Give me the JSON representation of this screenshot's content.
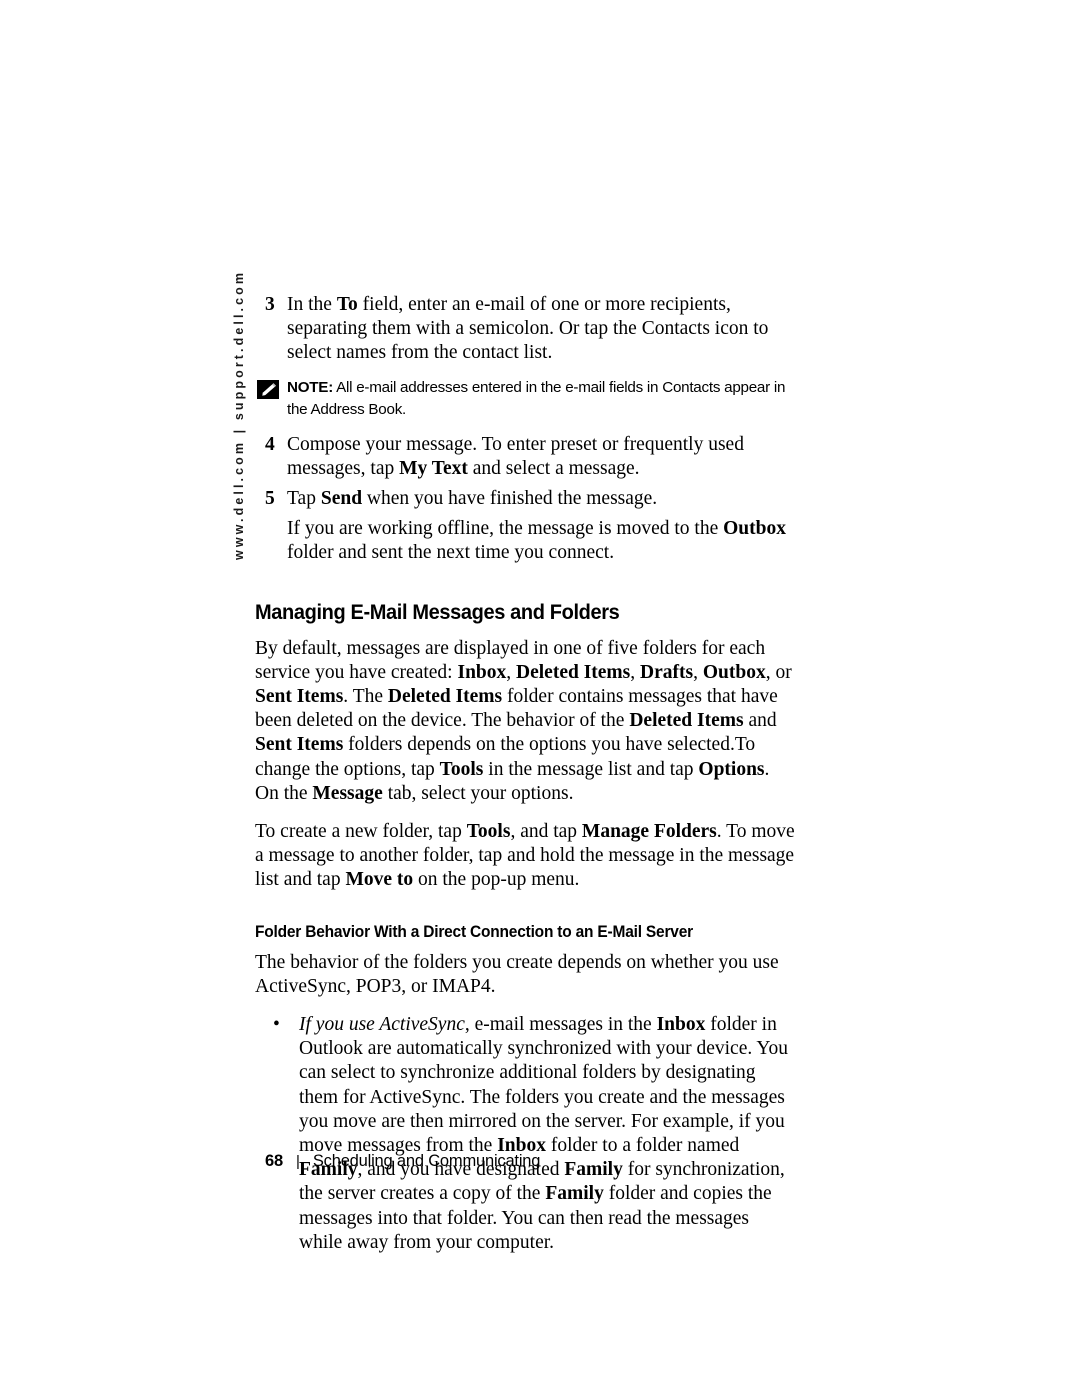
{
  "side_rule": {
    "text": "www.dell.com | support.dell.com"
  },
  "steps": [
    {
      "number": "3",
      "text_parts": [
        {
          "t": "In the ",
          "style": "normal"
        },
        {
          "t": "To",
          "style": "bold"
        },
        {
          "t": " field, enter an e-mail of one or more recipients, separating them with a semicolon. Or tap the Contacts icon to select names from the contact list.",
          "style": "normal"
        }
      ]
    },
    {
      "number": "4",
      "text_parts": [
        {
          "t": "Compose your message. To enter preset or frequently used messages, tap ",
          "style": "normal"
        },
        {
          "t": "My Text",
          "style": "bold"
        },
        {
          "t": " and select a message.",
          "style": "normal"
        }
      ]
    },
    {
      "number": "5",
      "text_parts": [
        {
          "t": "Tap ",
          "style": "normal"
        },
        {
          "t": "Send",
          "style": "bold"
        },
        {
          "t": " when you have finished the message.",
          "style": "normal"
        }
      ]
    }
  ],
  "note": {
    "icon": "pencil-note-icon",
    "label": "NOTE:",
    "text": " All e-mail addresses entered in the e-mail fields in Contacts appear in the Address Book."
  },
  "step5_continuation": {
    "parts": [
      {
        "t": "If you are working offline, the message is moved to the ",
        "style": "normal"
      },
      {
        "t": "Outbox",
        "style": "bold"
      },
      {
        "t": " folder and sent the next time you connect.",
        "style": "normal"
      }
    ]
  },
  "section_heading": "Managing E-Mail Messages and Folders",
  "paragraphs": [
    {
      "parts": [
        {
          "t": "By default, messages are displayed in one of five folders for each service you have created: ",
          "style": "normal"
        },
        {
          "t": "Inbox",
          "style": "bold"
        },
        {
          "t": ", ",
          "style": "normal"
        },
        {
          "t": "Deleted Items",
          "style": "bold"
        },
        {
          "t": ", ",
          "style": "normal"
        },
        {
          "t": "Drafts",
          "style": "bold"
        },
        {
          "t": ", ",
          "style": "normal"
        },
        {
          "t": "Outbox",
          "style": "bold"
        },
        {
          "t": ", or ",
          "style": "normal"
        },
        {
          "t": "Sent Items",
          "style": "bold"
        },
        {
          "t": ". The ",
          "style": "normal"
        },
        {
          "t": "Deleted Items",
          "style": "bold"
        },
        {
          "t": " folder contains messages that have been deleted on the device. The behavior of the ",
          "style": "normal"
        },
        {
          "t": "Deleted Items",
          "style": "bold"
        },
        {
          "t": " and ",
          "style": "normal"
        },
        {
          "t": "Sent Items",
          "style": "bold"
        },
        {
          "t": " folders depends on the options you have selected.To change the options, tap ",
          "style": "normal"
        },
        {
          "t": "Tools",
          "style": "bold"
        },
        {
          "t": " in the message list and tap ",
          "style": "normal"
        },
        {
          "t": "Options",
          "style": "bold"
        },
        {
          "t": ". On the ",
          "style": "normal"
        },
        {
          "t": "Message",
          "style": "bold"
        },
        {
          "t": " tab, select your options.",
          "style": "normal"
        }
      ]
    },
    {
      "parts": [
        {
          "t": "To create a new folder, tap ",
          "style": "normal"
        },
        {
          "t": "Tools",
          "style": "bold"
        },
        {
          "t": ", and tap ",
          "style": "normal"
        },
        {
          "t": "Manage Folders",
          "style": "bold"
        },
        {
          "t": ". To move a message to another folder, tap and hold the message in the message list and tap ",
          "style": "normal"
        },
        {
          "t": "Move to",
          "style": "bold"
        },
        {
          "t": " on the pop-up menu.",
          "style": "normal"
        }
      ]
    }
  ],
  "sub_heading": "Folder Behavior With a Direct Connection to an E-Mail Server",
  "sub_paragraph": {
    "parts": [
      {
        "t": "The behavior of the folders you create depends on whether you use ActiveSync, POP3, or IMAP4.",
        "style": "normal"
      }
    ]
  },
  "bullets": [
    {
      "marker": "•",
      "parts": [
        {
          "t": "If you use ActiveSync",
          "style": "italic"
        },
        {
          "t": ", e-mail messages in the ",
          "style": "normal"
        },
        {
          "t": "Inbox",
          "style": "bold"
        },
        {
          "t": " folder in Outlook are automatically synchronized with your device. You can select to synchronize additional folders by designating them for ActiveSync. The folders you create and the messages you move are then mirrored on the server. For example, if you move messages from the ",
          "style": "normal"
        },
        {
          "t": "Inbox",
          "style": "bold"
        },
        {
          "t": " folder to a folder named ",
          "style": "normal"
        },
        {
          "t": "Family",
          "style": "bold"
        },
        {
          "t": ", and you have designated ",
          "style": "normal"
        },
        {
          "t": "Family",
          "style": "bold"
        },
        {
          "t": " for synchronization, the server creates a copy of the ",
          "style": "normal"
        },
        {
          "t": "Family",
          "style": "bold"
        },
        {
          "t": " folder and copies the messages into that folder. You can then read the messages while away from your computer.",
          "style": "normal"
        }
      ]
    }
  ],
  "footer": {
    "page_number": "68",
    "separator": "|",
    "title": "Scheduling and Communicating"
  },
  "colors": {
    "text": "#000000",
    "background": "#ffffff",
    "note_icon_bg": "#000000"
  }
}
